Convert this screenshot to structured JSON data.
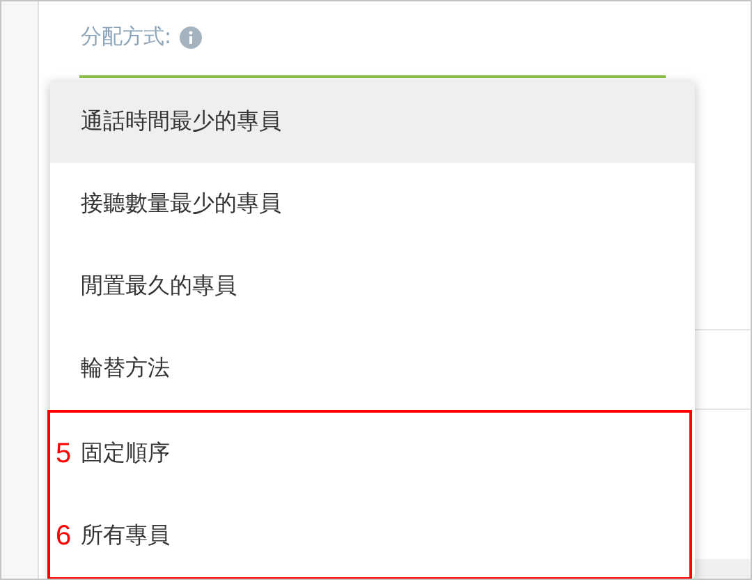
{
  "field": {
    "label": "分配方式:",
    "focused": true
  },
  "menu": {
    "items": [
      {
        "label": "通話時間最少的專員",
        "selected": true
      },
      {
        "label": "接聽數量最少的專員",
        "selected": false
      },
      {
        "label": "閒置最久的專員",
        "selected": false
      },
      {
        "label": "輪替方法",
        "selected": false
      },
      {
        "label": "固定順序",
        "selected": false,
        "callout": "5"
      },
      {
        "label": "所有專員",
        "selected": false,
        "callout": "6"
      }
    ]
  }
}
